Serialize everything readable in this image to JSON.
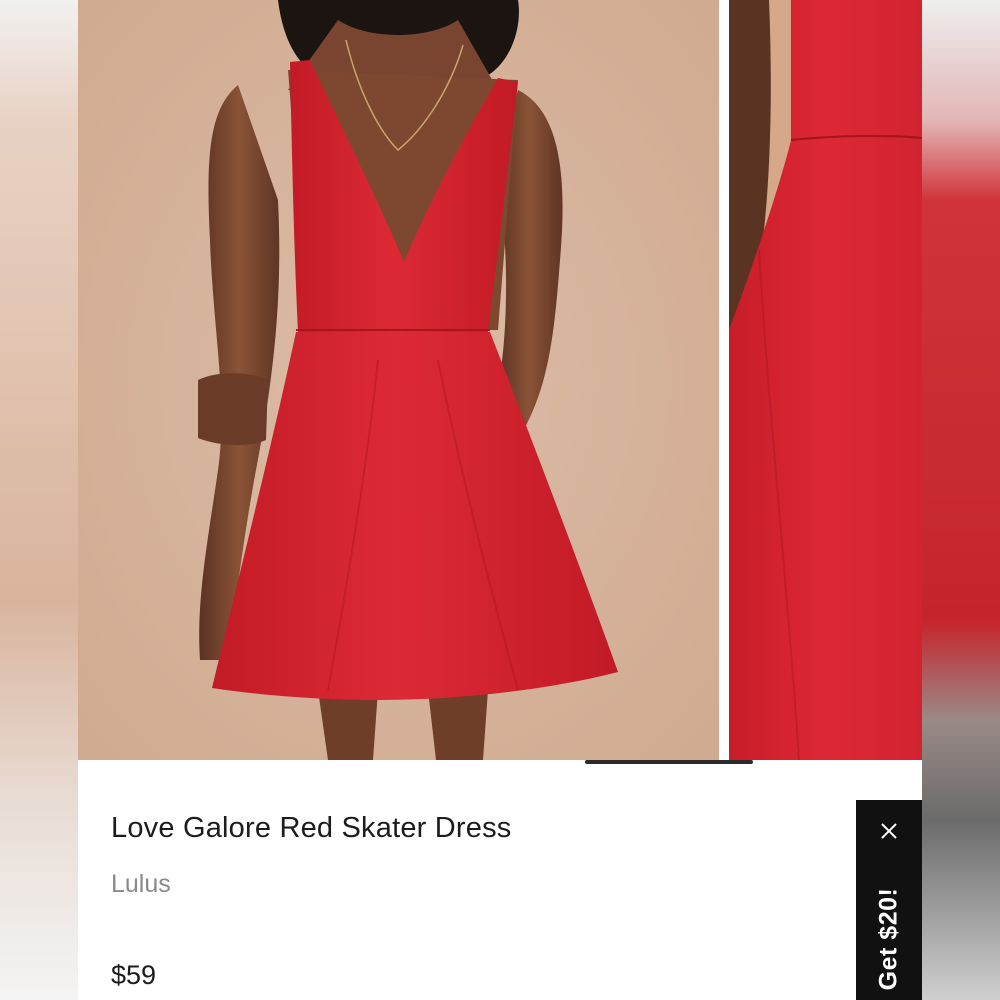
{
  "product": {
    "title": "Love Galore Red Skater Dress",
    "brand": "Lulus",
    "price": "$59"
  },
  "promo": {
    "label": "Get $20!",
    "close_icon": "close-icon"
  },
  "gallery": {
    "images": [
      "model-wearing-red-dress-photo",
      "dress-detail-closeup-photo"
    ]
  },
  "colors": {
    "backdrop": "#d9b49c",
    "dress": "#d3222e",
    "promo_bg": "#111111",
    "title_text": "#1c1c1c",
    "brand_text": "#8a8a8a"
  }
}
